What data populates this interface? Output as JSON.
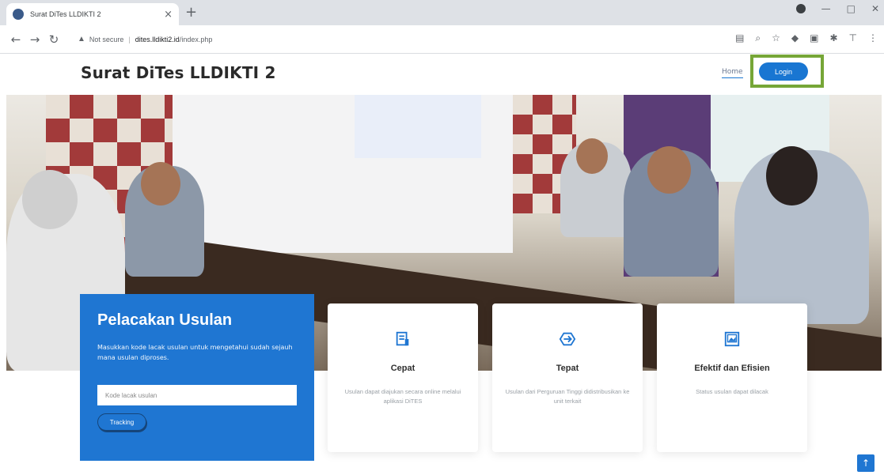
{
  "browser": {
    "tab_title": "Surat DiTes LLDIKTI 2",
    "tab_close": "×",
    "new_tab": "+",
    "security_label": "Not secure",
    "url_host": "dites.lldikti2.id",
    "url_path": "/index.php"
  },
  "header": {
    "brand": "Surat DiTes LLDIKTI 2",
    "nav_home": "Home",
    "login_label": "Login",
    "highlight_color": "#76a637"
  },
  "tracking": {
    "title": "Pelacakan Usulan",
    "description": "Masukkan kode lacak usulan untuk mengetahui sudah sejauh mana usulan diproses.",
    "input_placeholder": "Kode lacak usulan",
    "button_label": "Tracking"
  },
  "features": [
    {
      "icon": "document-list-icon",
      "title": "Cepat",
      "description": "Usulan dapat diajukan secara online melalui aplikasi DiTES"
    },
    {
      "icon": "target-arrow-icon",
      "title": "Tepat",
      "description": "Usulan dari Perguruan Tinggi didistribusikan ke unit terkait"
    },
    {
      "icon": "image-frame-icon",
      "title": "Efektif dan Efisien",
      "description": "Status usulan dapat dilacak"
    }
  ],
  "accent_color": "#1f76d2",
  "back_to_top": "↑"
}
